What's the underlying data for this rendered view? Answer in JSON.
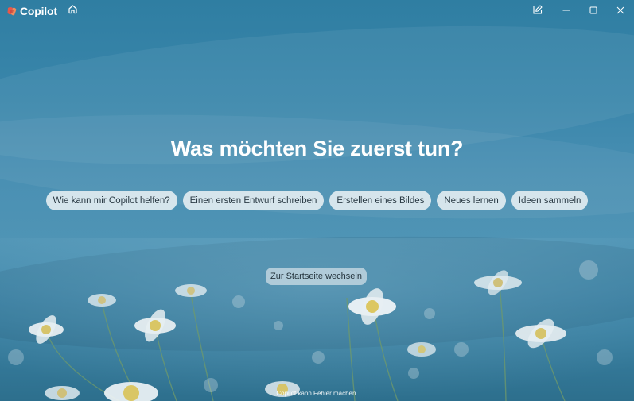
{
  "app": {
    "name": "Copilot",
    "logo_icon": "copilot-logo-icon",
    "home_icon": "home-icon"
  },
  "window_controls": {
    "compose_icon": "new-chat-compose-icon",
    "minimize_icon": "minimize-icon",
    "maximize_icon": "maximize-icon",
    "close_icon": "close-icon"
  },
  "main": {
    "headline": "Was möchten Sie zuerst tun?",
    "suggestions": [
      "Wie kann mir Copilot helfen?",
      "Einen ersten Entwurf schreiben",
      "Erstellen eines Bildes",
      "Neues lernen",
      "Ideen sammeln"
    ],
    "start_page_button": "Zur Startseite wechseln"
  },
  "footer": {
    "disclaimer": "Copilot kann Fehler machen."
  },
  "colors": {
    "background_top": "#2f7ea2",
    "background_mid": "#4f94b5",
    "chip_background": "#e8f0f4",
    "chip_text": "#2b3b45",
    "text_light": "#ffffff"
  }
}
